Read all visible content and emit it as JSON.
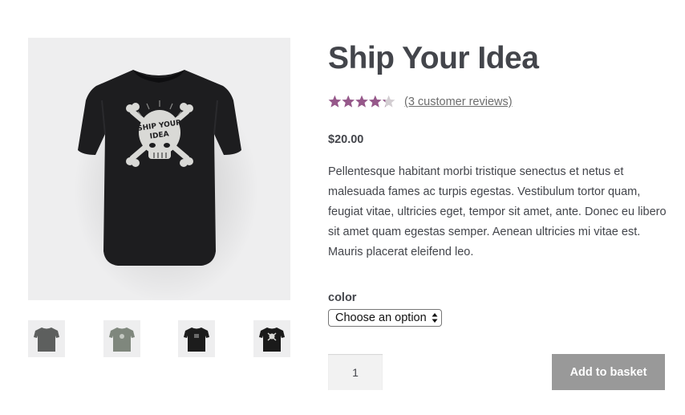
{
  "product": {
    "title": "Ship Your Idea",
    "rating": {
      "stars_filled_fraction": 0.85,
      "max": 5,
      "star_color": "#96588a",
      "empty_star_color": "#d3ced2",
      "reviews_link": "(3 customer reviews)"
    },
    "price": "$20.00",
    "description": "Pellentesque habitant morbi tristique senectus et netus et malesuada fames ac turpis egestas. Vestibulum tortor quam, feugiat vitae, ultricies eget, tempor sit amet, ante. Donec eu libero sit amet quam egestas semper. Aenean ultricies mi vitae est. Mauris placerat eleifend leo."
  },
  "gallery": {
    "main_image": "black-tshirt-skull-crossbones-image",
    "thumbnails": [
      {
        "name": "grey-tshirt-thumbnail",
        "shirt_color": "#5d5f5e"
      },
      {
        "name": "green-grey-tshirt-thumbnail",
        "shirt_color": "#7f877d"
      },
      {
        "name": "black-tshirt-thumbnail",
        "shirt_color": "#1c1c1c"
      },
      {
        "name": "black-tshirt-skull-thumbnail",
        "shirt_color": "#1a1a1a"
      }
    ]
  },
  "variations": {
    "label": "color",
    "select_value": "Choose an option"
  },
  "cart": {
    "quantity": "1",
    "add_button_label": "Add to basket"
  },
  "colors": {
    "text": "#43454b",
    "button_bg": "#999999",
    "image_bg": "#eeeeef",
    "accent": "#96588a"
  }
}
